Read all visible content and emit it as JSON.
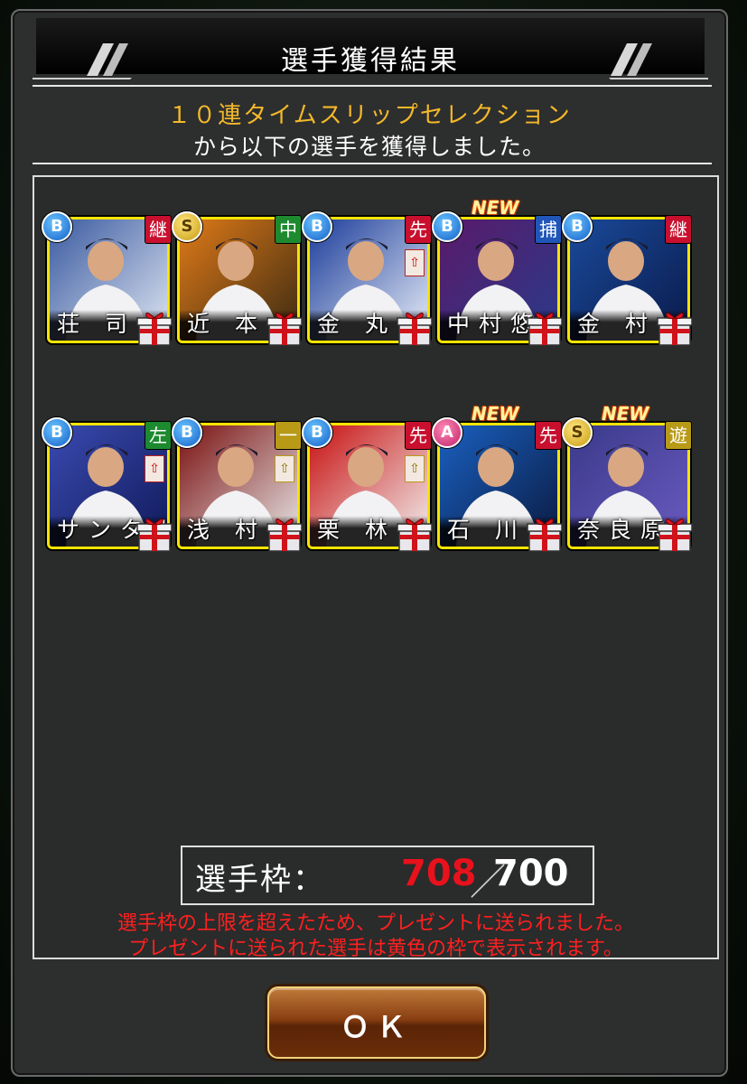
{
  "dialog": {
    "title": "選手獲得結果",
    "gacha_name": "１０連タイムスリップセレクション",
    "result_text": "から以下の選手を獲得しました。"
  },
  "players": [
    {
      "name": "荘 司",
      "rank": "B",
      "position": "継",
      "is_new": false,
      "upgrade": false
    },
    {
      "name": "近 本",
      "rank": "S",
      "position": "中",
      "is_new": false,
      "upgrade": false
    },
    {
      "name": "金 丸",
      "rank": "B",
      "position": "先",
      "is_new": false,
      "upgrade": true
    },
    {
      "name": "中村悠",
      "rank": "B",
      "position": "捕",
      "is_new": true,
      "upgrade": false
    },
    {
      "name": "金 村",
      "rank": "B",
      "position": "継",
      "is_new": false,
      "upgrade": false
    },
    {
      "name": "サンタナ",
      "rank": "B",
      "position": "左",
      "is_new": false,
      "upgrade": true
    },
    {
      "name": "浅 村",
      "rank": "B",
      "position": "一",
      "is_new": false,
      "upgrade": true
    },
    {
      "name": "栗 林",
      "rank": "B",
      "position": "先",
      "is_new": false,
      "upgrade": true
    },
    {
      "name": "石 川",
      "rank": "A",
      "position": "先",
      "is_new": true,
      "upgrade": false
    },
    {
      "name": "奈良原",
      "rank": "S",
      "position": "遊",
      "is_new": true,
      "upgrade": false
    }
  ],
  "labels": {
    "new_badge": "NEW",
    "gift_icon": "gift-box-icon",
    "upgrade_icon": "upgrade-arrow-icon"
  },
  "roster": {
    "label": "選手枠：",
    "current": "708",
    "separator": "／",
    "max": "700"
  },
  "warnings": {
    "line1": "選手枠の上限を超えたため、プレゼントに送られました。",
    "line2": "プレゼントに送られた選手は黄色の枠で表示されます。"
  },
  "button": {
    "ok_label": "ＯＫ"
  },
  "colors": {
    "accent_gold": "#f4b92a",
    "frame_yellow": "#f5e400",
    "warning_red": "#ff2020",
    "count_red": "#e8121c"
  }
}
